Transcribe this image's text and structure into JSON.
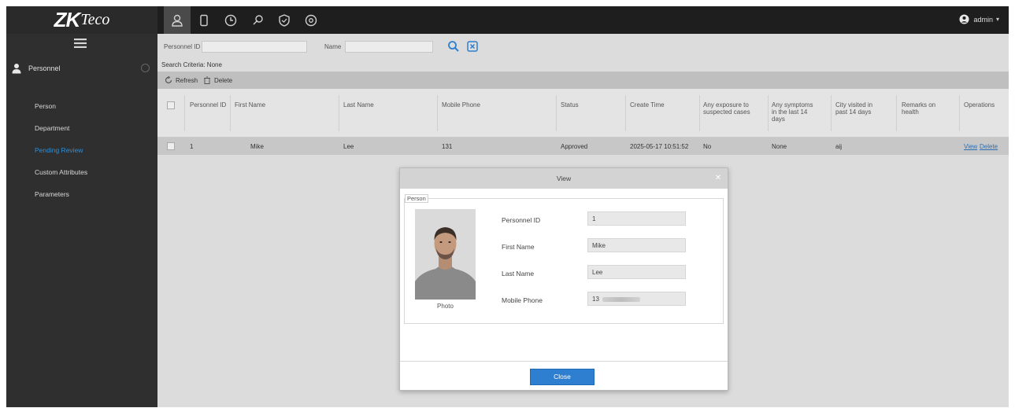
{
  "app": {
    "logo": {
      "text": "ZK",
      "text2": "Teco"
    },
    "user": {
      "name": "admin"
    }
  },
  "topnav": {
    "icons": [
      "person-icon",
      "device-icon",
      "clock-icon",
      "access-icon",
      "shield-icon",
      "settings-icon"
    ],
    "active_index": 0
  },
  "sidebar": {
    "module_label": "Personnel",
    "items": [
      {
        "label": "Person"
      },
      {
        "label": "Department"
      },
      {
        "label": "Pending Review"
      },
      {
        "label": "Custom Attributes"
      },
      {
        "label": "Parameters"
      }
    ],
    "active_index": 2
  },
  "search": {
    "personnel_id_label": "Personnel ID",
    "name_label": "Name",
    "criteria_text": "Search Criteria: None"
  },
  "toolbar": {
    "refresh_label": "Refresh",
    "delete_label": "Delete"
  },
  "table": {
    "headers": [
      "Personnel ID",
      "First Name",
      "Last Name",
      "Mobile Phone",
      "Status",
      "Create Time",
      "Any exposure to suspected cases",
      "Any symptoms in the last 14 days",
      "City visited in past 14 days",
      "Remarks on health",
      "Operations"
    ],
    "rows": [
      {
        "id": "1",
        "first_name": "Mike",
        "last_name": "Lee",
        "mobile": "131",
        "status": "Approved",
        "create_time": "2025-05-17 10:51:52",
        "exposure": "No",
        "symptoms": "None",
        "city": "aij",
        "remarks": "",
        "view": "View",
        "delete": "Delete"
      }
    ]
  },
  "modal": {
    "title": "View",
    "section_label": "Person",
    "photo_label": "Photo",
    "fields": [
      {
        "label": "Personnel ID",
        "value": "1"
      },
      {
        "label": "First Name",
        "value": "Mike"
      },
      {
        "label": "Last Name",
        "value": "Lee"
      },
      {
        "label": "Mobile Phone",
        "value": "13"
      }
    ],
    "close_label": "Close"
  },
  "colors": {
    "accent": "#2f7fd0",
    "topbar": "#1e1e1e",
    "sidebar": "#2f2f2f",
    "active_link": "#2e8fd6"
  }
}
